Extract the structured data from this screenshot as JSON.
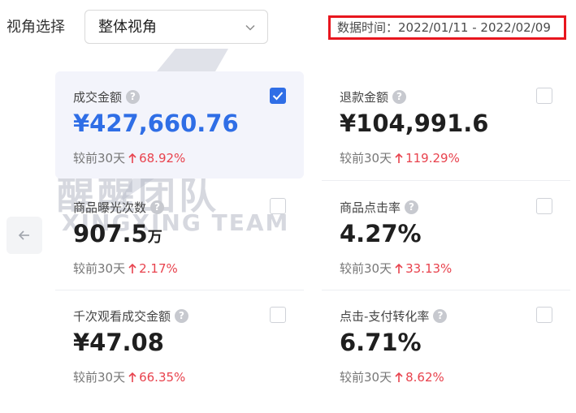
{
  "header": {
    "view_label": "视角选择",
    "view_select_value": "整体视角",
    "date_range": "数据时间：2022/01/11 - 2022/02/09"
  },
  "watermark": {
    "cn_text": "醒醒团队",
    "en_text": "XINGXING TEAM"
  },
  "cards": [
    {
      "title": "成交金额",
      "value": "¥427,660.76",
      "unit": "",
      "compare_label": "较前30天",
      "compare_value": "68.92%",
      "checked": true
    },
    {
      "title": "退款金额",
      "value": "¥104,991.6",
      "unit": "",
      "compare_label": "较前30天",
      "compare_value": "119.29%",
      "checked": false
    },
    {
      "title": "商品曝光次数",
      "value": "907.5",
      "unit": "万",
      "compare_label": "较前30天",
      "compare_value": "2.17%",
      "checked": false
    },
    {
      "title": "商品点击率",
      "value": "4.27%",
      "unit": "",
      "compare_label": "较前30天",
      "compare_value": "33.13%",
      "checked": false
    },
    {
      "title": "千次观看成交金额",
      "value": "¥47.08",
      "unit": "",
      "compare_label": "较前30天",
      "compare_value": "66.35%",
      "checked": false
    },
    {
      "title": "点击-支付转化率",
      "value": "6.71%",
      "unit": "",
      "compare_label": "较前30天",
      "compare_value": "8.62%",
      "checked": false
    }
  ],
  "help_glyph": "?",
  "icons": {
    "back": "arrow-left-icon",
    "select": "chevron-down-icon",
    "help": "question-circle-icon",
    "trend": "arrow-up-icon",
    "check": "checkmark-icon"
  },
  "colors": {
    "accent": "#2f6ee6",
    "positive_change": "#e8424d",
    "selected_card_bg": "#f3f4fb",
    "date_border": "#e8161e"
  }
}
